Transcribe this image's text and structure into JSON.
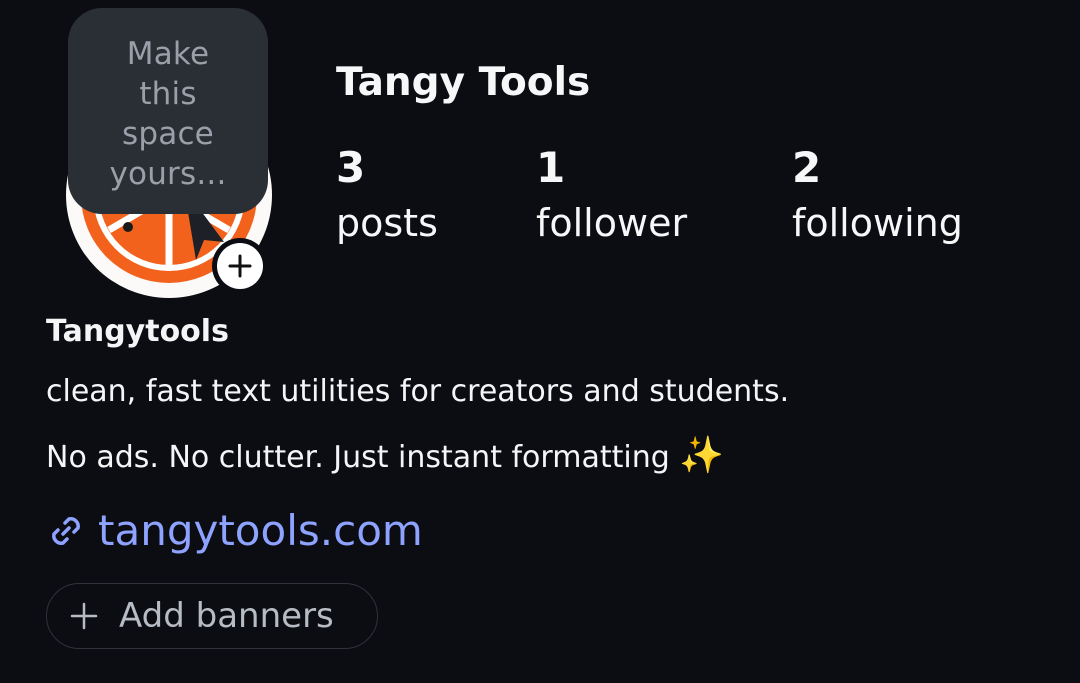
{
  "tooltip": {
    "line1": "Make",
    "line2": "this",
    "line3": "space",
    "line4": "yours..."
  },
  "profile": {
    "name": "Tangy Tools",
    "display_name": "Tangytools",
    "avatar_icon": "orange-slice-logo",
    "add_photo_icon": "plus-icon"
  },
  "stats": {
    "posts": {
      "value": "3",
      "label": "posts"
    },
    "followers": {
      "value": "1",
      "label": "follower"
    },
    "following": {
      "value": "2",
      "label": "following"
    }
  },
  "bio": {
    "line1": "clean, fast text utilities for creators and students.",
    "line2": "No ads. No clutter. Just instant formatting",
    "line2_emoji": "✨"
  },
  "website": {
    "icon": "link-icon",
    "text": "tangytools.com"
  },
  "add_banners": {
    "icon": "plus-icon",
    "label": "Add banners"
  },
  "colors": {
    "background": "#0c0d12",
    "link": "#8ea2ff",
    "tooltip_bg": "#2a2e35",
    "avatar_orange": "#f2621c"
  }
}
